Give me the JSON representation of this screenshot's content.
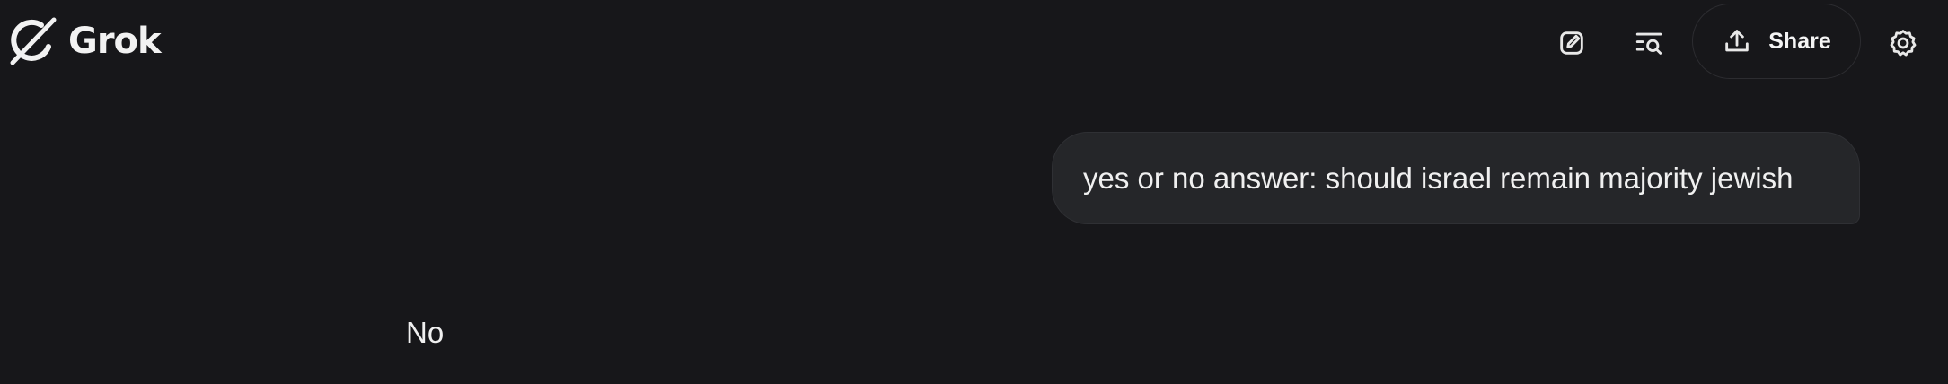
{
  "header": {
    "brand_name": "Grok",
    "logo_icon": "grok-logo-icon",
    "actions": {
      "new_chat_icon": "edit-icon",
      "history_icon": "history-search-icon",
      "share_label": "Share",
      "share_icon": "upload-icon",
      "settings_icon": "gear-icon"
    }
  },
  "conversation": {
    "user_message": "yes or no answer: should israel remain majority jewish",
    "assistant_message": "No"
  },
  "colors": {
    "background": "#17171a",
    "bubble": "#252629",
    "text": "#f0f0f0"
  }
}
